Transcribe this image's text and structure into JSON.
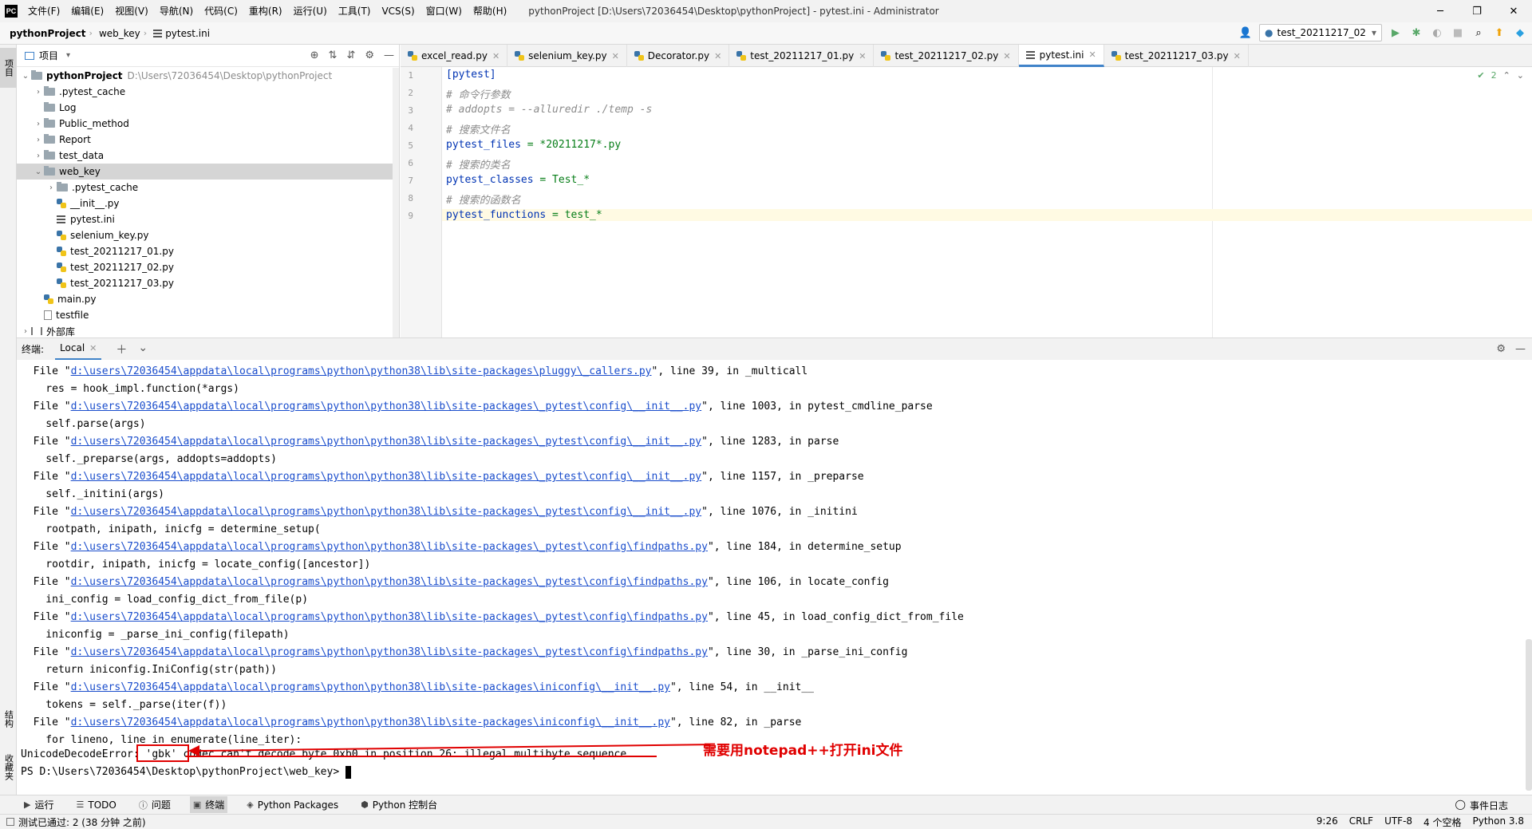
{
  "titlebar": {
    "logo": "PC",
    "menu": [
      "文件(F)",
      "编辑(E)",
      "视图(V)",
      "导航(N)",
      "代码(C)",
      "重构(R)",
      "运行(U)",
      "工具(T)",
      "VCS(S)",
      "窗口(W)",
      "帮助(H)"
    ],
    "window_title": "pythonProject [D:\\Users\\72036454\\Desktop\\pythonProject] - pytest.ini - Administrator",
    "controls": {
      "minimize": "─",
      "maximize": "❐",
      "close": "✕"
    }
  },
  "navbar": {
    "project": "pythonProject",
    "folder": "web_key",
    "file": "pytest.ini",
    "run_config": "test_20211217_02"
  },
  "left_stripe": {
    "project_tab": "项目",
    "structure_tab": "结构",
    "favorites_tab": "收藏夹"
  },
  "project_panel": {
    "title": "项目",
    "root": {
      "name": "pythonProject",
      "path": "D:\\Users\\72036454\\Desktop\\pythonProject"
    },
    "items": [
      {
        "label": ".pytest_cache",
        "kind": "folder",
        "expanded": false
      },
      {
        "label": "Log",
        "kind": "folder",
        "expanded": null
      },
      {
        "label": "Public_method",
        "kind": "folder",
        "expanded": false
      },
      {
        "label": "Report",
        "kind": "folder",
        "expanded": false
      },
      {
        "label": "test_data",
        "kind": "folder",
        "expanded": false
      },
      {
        "label": "web_key",
        "kind": "folder",
        "expanded": true
      },
      {
        "label": ".pytest_cache",
        "kind": "folder",
        "expanded": false
      },
      {
        "label": "__init__.py",
        "kind": "py"
      },
      {
        "label": "pytest.ini",
        "kind": "ini"
      },
      {
        "label": "selenium_key.py",
        "kind": "py"
      },
      {
        "label": "test_20211217_01.py",
        "kind": "py"
      },
      {
        "label": "test_20211217_02.py",
        "kind": "py"
      },
      {
        "label": "test_20211217_03.py",
        "kind": "py"
      },
      {
        "label": "main.py",
        "kind": "py"
      },
      {
        "label": "testfile",
        "kind": "txt"
      },
      {
        "label": "外部库",
        "kind": "libs"
      }
    ]
  },
  "editor": {
    "tabs": [
      "excel_read.py",
      "selenium_key.py",
      "Decorator.py",
      "test_20211217_01.py",
      "test_20211217_02.py",
      "pytest.ini",
      "test_20211217_03.py"
    ],
    "active_tab": "pytest.ini",
    "inspection_count": "2",
    "line_numbers": [
      "1",
      "2",
      "3",
      "4",
      "5",
      "6",
      "7",
      "8",
      "9"
    ],
    "lines": {
      "l1": "[pytest]",
      "l2": "# 命令行参数",
      "l3": "# addopts = --alluredir ./temp -s",
      "l4": "# 搜索文件名",
      "l5_key": "pytest_files",
      "l5_val": " = *20211217*.py",
      "l6": "# 搜索的类名",
      "l7_key": "pytest_classes",
      "l7_val": " = Test_*",
      "l8": "# 搜索的函数名",
      "l9_key": "pytest_functions",
      "l9_val": " = test_*"
    }
  },
  "terminal": {
    "label": "终端:",
    "tab": "Local",
    "trace": [
      {
        "pre": "  File \"",
        "link": "d:\\users\\72036454\\appdata\\local\\programs\\python\\python38\\lib\\site-packages\\pluggy\\_callers.py",
        "post": "\", line 39, in _multicall"
      },
      {
        "text": "    res = hook_impl.function(*args)"
      },
      {
        "pre": "  File \"",
        "link": "d:\\users\\72036454\\appdata\\local\\programs\\python\\python38\\lib\\site-packages\\_pytest\\config\\__init__.py",
        "post": "\", line 1003, in pytest_cmdline_parse"
      },
      {
        "text": "    self.parse(args)"
      },
      {
        "pre": "  File \"",
        "link": "d:\\users\\72036454\\appdata\\local\\programs\\python\\python38\\lib\\site-packages\\_pytest\\config\\__init__.py",
        "post": "\", line 1283, in parse"
      },
      {
        "text": "    self._preparse(args, addopts=addopts)"
      },
      {
        "pre": "  File \"",
        "link": "d:\\users\\72036454\\appdata\\local\\programs\\python\\python38\\lib\\site-packages\\_pytest\\config\\__init__.py",
        "post": "\", line 1157, in _preparse"
      },
      {
        "text": "    self._initini(args)"
      },
      {
        "pre": "  File \"",
        "link": "d:\\users\\72036454\\appdata\\local\\programs\\python\\python38\\lib\\site-packages\\_pytest\\config\\__init__.py",
        "post": "\", line 1076, in _initini"
      },
      {
        "text": "    rootpath, inipath, inicfg = determine_setup("
      },
      {
        "pre": "  File \"",
        "link": "d:\\users\\72036454\\appdata\\local\\programs\\python\\python38\\lib\\site-packages\\_pytest\\config\\findpaths.py",
        "post": "\", line 184, in determine_setup"
      },
      {
        "text": "    rootdir, inipath, inicfg = locate_config([ancestor])"
      },
      {
        "pre": "  File \"",
        "link": "d:\\users\\72036454\\appdata\\local\\programs\\python\\python38\\lib\\site-packages\\_pytest\\config\\findpaths.py",
        "post": "\", line 106, in locate_config"
      },
      {
        "text": "    ini_config = load_config_dict_from_file(p)"
      },
      {
        "pre": "  File \"",
        "link": "d:\\users\\72036454\\appdata\\local\\programs\\python\\python38\\lib\\site-packages\\_pytest\\config\\findpaths.py",
        "post": "\", line 45, in load_config_dict_from_file"
      },
      {
        "text": "    iniconfig = _parse_ini_config(filepath)"
      },
      {
        "pre": "  File \"",
        "link": "d:\\users\\72036454\\appdata\\local\\programs\\python\\python38\\lib\\site-packages\\_pytest\\config\\findpaths.py",
        "post": "\", line 30, in _parse_ini_config"
      },
      {
        "text": "    return iniconfig.IniConfig(str(path))"
      },
      {
        "pre": "  File \"",
        "link": "d:\\users\\72036454\\appdata\\local\\programs\\python\\python38\\lib\\site-packages\\iniconfig\\__init__.py",
        "post": "\", line 54, in __init__"
      },
      {
        "text": "    tokens = self._parse(iter(f))"
      },
      {
        "pre": "  File \"",
        "link": "d:\\users\\72036454\\appdata\\local\\programs\\python\\python38\\lib\\site-packages\\iniconfig\\__init__.py",
        "post": "\", line 82, in _parse"
      },
      {
        "text": "    for lineno, line in enumerate(line_iter):"
      }
    ],
    "error_line": "UnicodeDecodeError: 'gbk' codec can't decode byte 0xb0 in position 26: illegal multibyte sequence",
    "prompt": "PS D:\\Users\\72036454\\Desktop\\pythonProject\\web_key>",
    "annotation": "需要用notepad++打开ini文件",
    "annotation_color": "#e00000"
  },
  "bottom_toolbar": {
    "items": [
      {
        "icon": "run-icon",
        "label": "运行"
      },
      {
        "icon": "todo-icon",
        "label": "TODO"
      },
      {
        "icon": "problems-icon",
        "label": "问题"
      },
      {
        "icon": "terminal-icon",
        "label": "终端"
      },
      {
        "icon": "python-packages-icon",
        "label": "Python Packages"
      },
      {
        "icon": "python-console-icon",
        "label": "Python 控制台"
      }
    ],
    "active": "终端",
    "event_log": "事件日志"
  },
  "statusbar": {
    "message": "测试已通过: 2 (38 分钟 之前)",
    "position": "9:26",
    "line_sep": "CRLF",
    "encoding": "UTF-8",
    "indent": "4 个空格",
    "interpreter": "Python 3.8"
  },
  "colors": {
    "accent": "#4083c9",
    "link": "#1a4dcc",
    "keyword": "#0033b3",
    "comment": "#8c8c8c",
    "value": "#067d17",
    "error": "#e00000"
  }
}
